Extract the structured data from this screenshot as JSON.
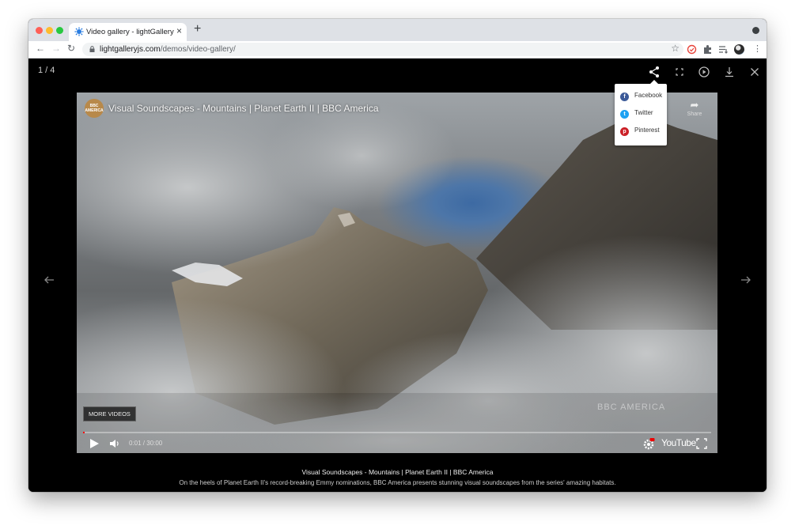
{
  "browser": {
    "tab": {
      "title": "Video gallery - lightGallery"
    },
    "address": {
      "host": "lightgalleryjs.com",
      "path": "/demos/video-gallery/"
    }
  },
  "gallery": {
    "counter": "1 / 4",
    "share_menu": {
      "items": [
        {
          "label": "Facebook",
          "color": "#3b5998",
          "icon": "facebook-icon"
        },
        {
          "label": "Twitter",
          "color": "#1da1f2",
          "icon": "twitter-icon"
        },
        {
          "label": "Pinterest",
          "color": "#cb2027",
          "icon": "pinterest-icon"
        }
      ]
    },
    "video": {
      "title": "Visual Soundscapes - Mountains | Planet Earth II | BBC America",
      "channel_badge": "BBC AMERICA",
      "share_label": "Share",
      "more_videos": "MORE VIDEOS",
      "time": "0:01 / 30:00",
      "progress": 0.001,
      "watermark": "BBC AMERICA",
      "youtube_label": "YouTube"
    },
    "caption": {
      "title": "Visual Soundscapes - Mountains | Planet Earth II | BBC America",
      "description": "On the heels of Planet Earth II's record-breaking Emmy nominations, BBC America presents stunning visual soundscapes from the series' amazing habitats."
    }
  }
}
